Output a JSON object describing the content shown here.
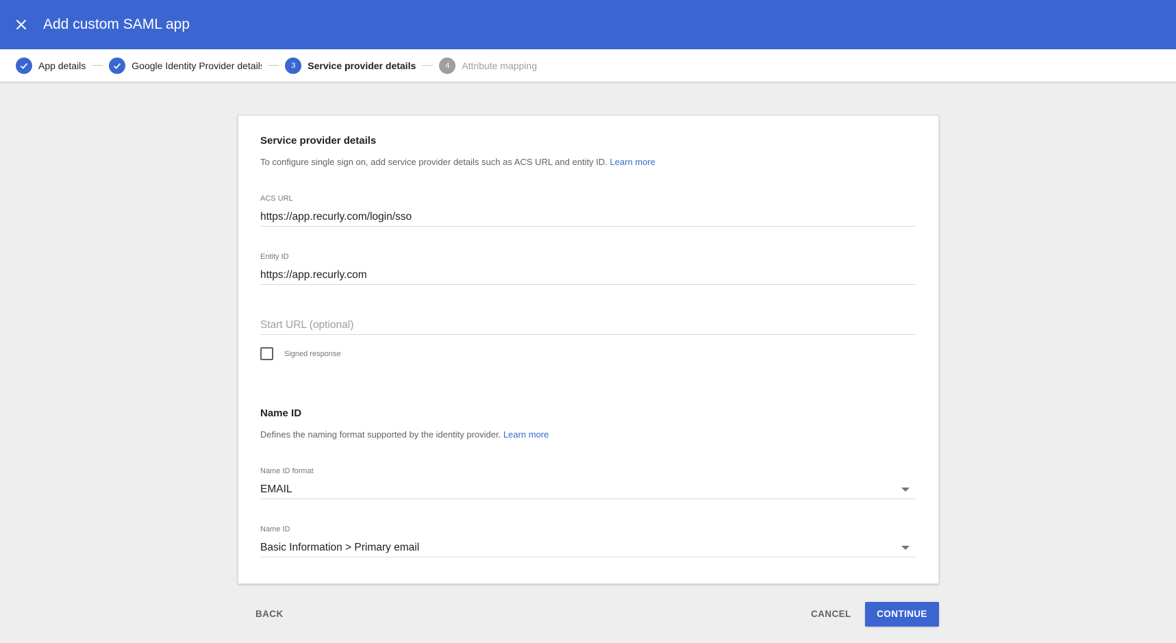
{
  "header": {
    "title": "Add custom SAML app",
    "close_icon": "close-icon",
    "background": "#3b66d1"
  },
  "stepper": {
    "steps": [
      {
        "number": "1",
        "label": "App details",
        "state": "done"
      },
      {
        "number": "2",
        "label": "Google Identity Provider details",
        "state": "done"
      },
      {
        "number": "3",
        "label": "Service provider details",
        "state": "active"
      },
      {
        "number": "4",
        "label": "Attribute mapping",
        "state": "pending"
      }
    ]
  },
  "service_provider": {
    "title": "Service provider details",
    "description": "To configure single sign on, add service provider details such as ACS URL and entity ID.",
    "learn_more": "Learn more",
    "acs_url": {
      "label": "ACS URL",
      "value": "https://app.recurly.com/login/sso"
    },
    "entity_id": {
      "label": "Entity ID",
      "value": "https://app.recurly.com"
    },
    "start_url": {
      "placeholder": "Start URL (optional)",
      "value": ""
    },
    "signed_response": {
      "label": "Signed response",
      "checked": false
    }
  },
  "name_id": {
    "title": "Name ID",
    "description": "Defines the naming format supported by the identity provider.",
    "learn_more": "Learn more",
    "format": {
      "label": "Name ID format",
      "value": "EMAIL"
    },
    "name_id": {
      "label": "Name ID",
      "value": "Basic Information > Primary email"
    }
  },
  "footer": {
    "back": "BACK",
    "cancel": "CANCEL",
    "continue": "CONTINUE"
  },
  "colors": {
    "accent": "#3b66d1",
    "background": "#eeeeee"
  }
}
